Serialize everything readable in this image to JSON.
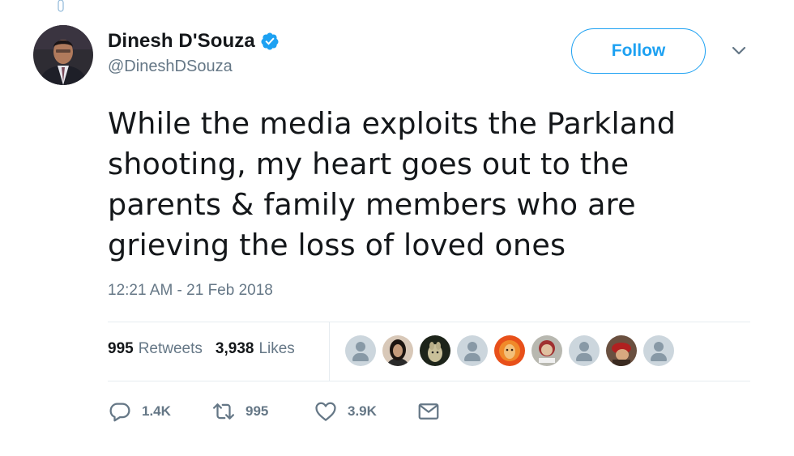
{
  "author": {
    "display_name": "Dinesh D'Souza",
    "handle": "@DineshDSouza",
    "verified": true,
    "avatar_icon": "user-photo-avatar"
  },
  "follow_button": {
    "label": "Follow"
  },
  "tweet": {
    "lines": [
      "While the media exploits the Parkland",
      "shooting, my heart goes out to the",
      "parents & family members who are",
      "grieving the loss of loved ones"
    ],
    "timestamp": "12:21 AM - 21 Feb 2018"
  },
  "stats": {
    "retweets": {
      "count": "995",
      "label": "Retweets"
    },
    "likes": {
      "count": "3,938",
      "label": "Likes"
    }
  },
  "liker_avatars": [
    "default",
    "photo",
    "photo",
    "default",
    "photo",
    "photo",
    "default",
    "photo",
    "default"
  ],
  "actions": {
    "reply": {
      "icon": "reply-icon",
      "count": "1.4K"
    },
    "retweet": {
      "icon": "retweet-icon",
      "count": "995"
    },
    "like": {
      "icon": "heart-icon",
      "count": "3.9K"
    },
    "message": {
      "icon": "envelope-icon"
    }
  },
  "colors": {
    "accent": "#1da1f2",
    "secondary_text": "#657786",
    "divider": "#e6ecf0"
  }
}
